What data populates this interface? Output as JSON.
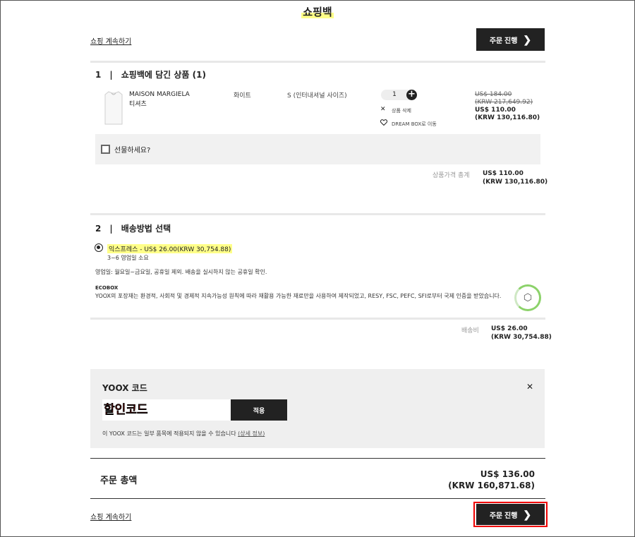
{
  "page": {
    "title": "쇼핑백"
  },
  "top": {
    "continue_link": "쇼핑 계속하기",
    "checkout_label": "주문 진행",
    "checkout_chevron": "❯"
  },
  "section1": {
    "number": "1",
    "separator": "|",
    "title": "쇼핑백에 담긴 상품 (1)",
    "item": {
      "brand": "MAISON MARGIELA",
      "category": "티셔츠",
      "color": "화이트",
      "size": "S (인터내셔널 사이즈)",
      "quantity": "1",
      "plus": "+",
      "delete_label": "상품 삭제",
      "move_label": "DREAM BOX로 이동",
      "old_price_usd": "US$ 184.00",
      "old_price_krw": "(KRW 217,649.92)",
      "price_usd": "US$ 110.00",
      "price_krw": "(KRW 130,116.80)"
    },
    "gift_label": "선물하세요?",
    "subtotal_label": "상품가격 총계",
    "subtotal_usd": "US$ 110.00",
    "subtotal_krw": "(KRW 130,116.80)"
  },
  "section2": {
    "number": "2",
    "separator": "|",
    "title": "배송방법 선택",
    "option_label": "익스프레스 - US$ 26.00(KRW 30,754.88)",
    "option_eta": "3~6 영업일 소요",
    "business_days": "영업일: 월요일~금요일, 공휴일 제외. 배송을 실시하지 않는 공휴일 확인.",
    "ecobox_title": "ECOBOX",
    "ecobox_text": "YOOX의 포장재는 환경적, 사회적 및 경제적 지속가능성 원칙에 따라 재활용 가능한 재료만을 사용하여 제작되었고, RESY, FSC, PEFC, SFI로부터 국제 인증을 받았습니다.",
    "shipping_label": "배송비",
    "shipping_usd": "US$ 26.00",
    "shipping_krw": "(KRW 30,754.88)"
  },
  "code": {
    "title": "YOOX 코드",
    "close": "✕",
    "input_value": "",
    "input_placeholder": "할인코드",
    "apply_label": "적용",
    "notice": "이 YOOX 코드는 일부 품목에 적용되지 않을 수 있습니다",
    "details_link": "(상세 정보)"
  },
  "total": {
    "label": "주문 총액",
    "usd": "US$ 136.00",
    "krw": "(KRW 160,871.68)"
  },
  "bottom": {
    "continue_link": "쇼핑 계속하기",
    "checkout_label": "주문 진행",
    "checkout_chevron": "❯"
  },
  "colors": {
    "highlight": "#ffff88",
    "dark_button": "#222222",
    "annotation_red": "#ee0000",
    "eco_green": "#8cd26a"
  },
  "icons": {
    "delete": "close-icon",
    "move": "heart-icon",
    "ecobox": "box-icon",
    "chevron": "chevron-right-icon"
  }
}
